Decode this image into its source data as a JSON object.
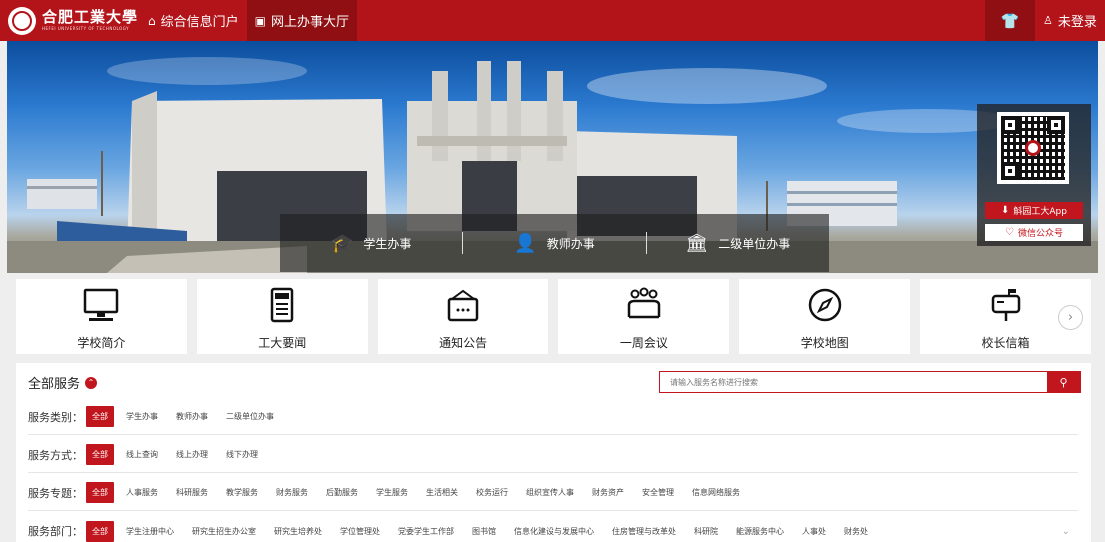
{
  "topbar": {
    "logo_cn": "合肥工業大學",
    "logo_en": "HEFEI UNIVERSITY OF TECHNOLOGY",
    "nav": [
      {
        "icon": "home-icon",
        "glyph": "⌂",
        "label": "综合信息门户"
      },
      {
        "icon": "monitor-icon",
        "glyph": "▣",
        "label": "网上办事大厅"
      }
    ],
    "shirt_glyph": "👕",
    "login_glyph": "♙",
    "login_label": "未登录"
  },
  "banner": {
    "roles": [
      {
        "icon": "graduation-cap-icon",
        "glyph": "🎓",
        "label": "学生办事"
      },
      {
        "icon": "teacher-icon",
        "glyph": "👤",
        "label": "教师办事"
      },
      {
        "icon": "building-gear-icon",
        "glyph": "🏛",
        "label": "二级单位办事"
      }
    ],
    "app_button": {
      "glyph": "⬇",
      "label": "斛园工大App"
    },
    "wechat_button": {
      "glyph": "♡",
      "label": "微信公众号"
    }
  },
  "cards": [
    {
      "icon": "monitor-icon",
      "label": "学校简介"
    },
    {
      "icon": "newspaper-icon",
      "label": "工大要闻"
    },
    {
      "icon": "notice-board-icon",
      "label": "通知公告"
    },
    {
      "icon": "meeting-icon",
      "label": "一周会议"
    },
    {
      "icon": "compass-icon",
      "label": "学校地图"
    },
    {
      "icon": "mailbox-icon",
      "label": "校长信箱"
    }
  ],
  "next_glyph": "›",
  "services": {
    "title": "全部服务",
    "toggle_glyph": "⌃",
    "search_placeholder": "请输入服务名称进行搜索",
    "search_glyph": "⚲",
    "filters": [
      {
        "label": "服务类别：",
        "options": [
          "全部",
          "学生办事",
          "教师办事",
          "二级单位办事"
        ]
      },
      {
        "label": "服务方式：",
        "options": [
          "全部",
          "线上查询",
          "线上办理",
          "线下办理"
        ]
      },
      {
        "label": "服务专题：",
        "options": [
          "全部",
          "人事服务",
          "科研服务",
          "教学服务",
          "财务服务",
          "后勤服务",
          "学生服务",
          "生活相关",
          "校务运行",
          "组织宣传人事",
          "财务资产",
          "安全管理",
          "信息网络服务"
        ]
      },
      {
        "label": "服务部门：",
        "options": [
          "全部",
          "学生注册中心",
          "研究生招生办公室",
          "研究生培养处",
          "学位管理处",
          "党委学生工作部",
          "图书馆",
          "信息化建设与发展中心",
          "住房管理与改革处",
          "科研院",
          "能源服务中心",
          "人事处",
          "财务处"
        ]
      }
    ],
    "expand_glyph": "⌄"
  }
}
